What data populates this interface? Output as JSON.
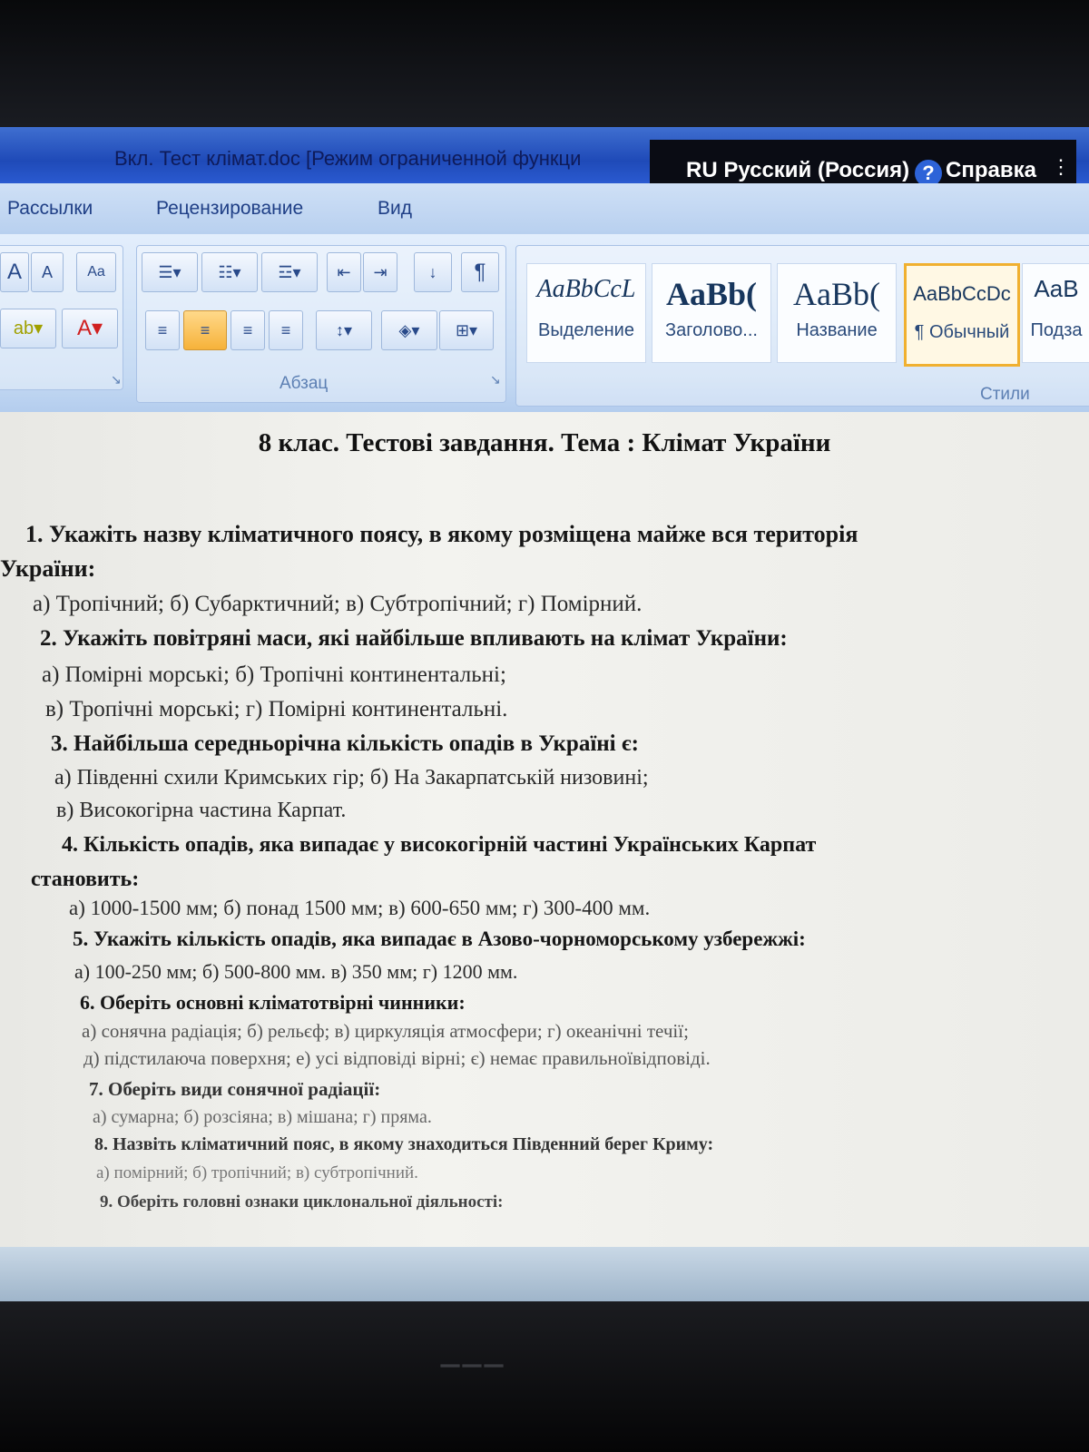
{
  "window": {
    "title": "Вкл. Тест клімат.doc [Режим ограниченной функци",
    "language": "RU Русский (Россия)",
    "help_label": "Справка"
  },
  "tabs": [
    "Рассылки",
    "Рецензирование",
    "Вид"
  ],
  "ribbon": {
    "paragraph_group_label": "Абзац",
    "styles_group_label": "Стили",
    "styles": [
      {
        "sample": "AaBbCcL",
        "name": "Выделение"
      },
      {
        "sample": "AaBb(",
        "name": "Заголово..."
      },
      {
        "sample": "AaBb(",
        "name": "Название"
      },
      {
        "sample": "AaBbCcDc",
        "name": "¶ Обычный"
      },
      {
        "sample": "AaB",
        "name": "Подза"
      }
    ]
  },
  "document": {
    "title": "8 клас. Тестові завдання. Тема : Клімат України",
    "lines": [
      "1. Укажіть назву кліматичного поясу, в якому розміщена майже вся територія",
      "України:",
      "а) Тропічний;  б) Субарктичний; в) Субтропічний;    г) Помірний.",
      "2. Укажіть повітряні маси, які найбільше впливають  на клімат України:",
      "а) Помірні морські; б) Тропічні континентальні;",
      "в) Тропічні морські; г) Помірні континентальні.",
      "3. Найбільша середньорічна кількість опадів в Україні є:",
      "а) Південні  схили Кримських гір; б) На  Закарпатській низовині;",
      "в) Високогірна частина  Карпат.",
      "4. Кількість опадів, яка випадає у високогірній частині Українських Карпат",
      "становить:",
      "а) 1000-1500 мм; б) понад 1500 мм; в) 600-650 мм; г) 300-400 мм.",
      "5. Укажіть кількість опадів, яка випадає в Азово-чорноморському узбережжі:",
      "а) 100-250 мм; б) 500-800 мм. в) 350 мм; г) 1200 мм.",
      "6. Оберіть  основні кліматотвірні чинники:",
      "а) сонячна радіація; б) рельєф; в) циркуляція атмосфери; г) океанічні течії;",
      "д) підстилаюча поверхня; е) усі відповіді вірні; є) немає правильноївідповіді.",
      "7. Оберіть види сонячної радіації:",
      "а) сумарна; б) розсіяна; в) мішана; г) пряма.",
      "8. Назвіть кліматичний пояс, в якому знаходиться Південний берег Криму:",
      "а) помірний; б) тропічний; в) субтропічний.",
      "9. Оберіть головні ознаки циклональної діяльності:"
    ]
  }
}
